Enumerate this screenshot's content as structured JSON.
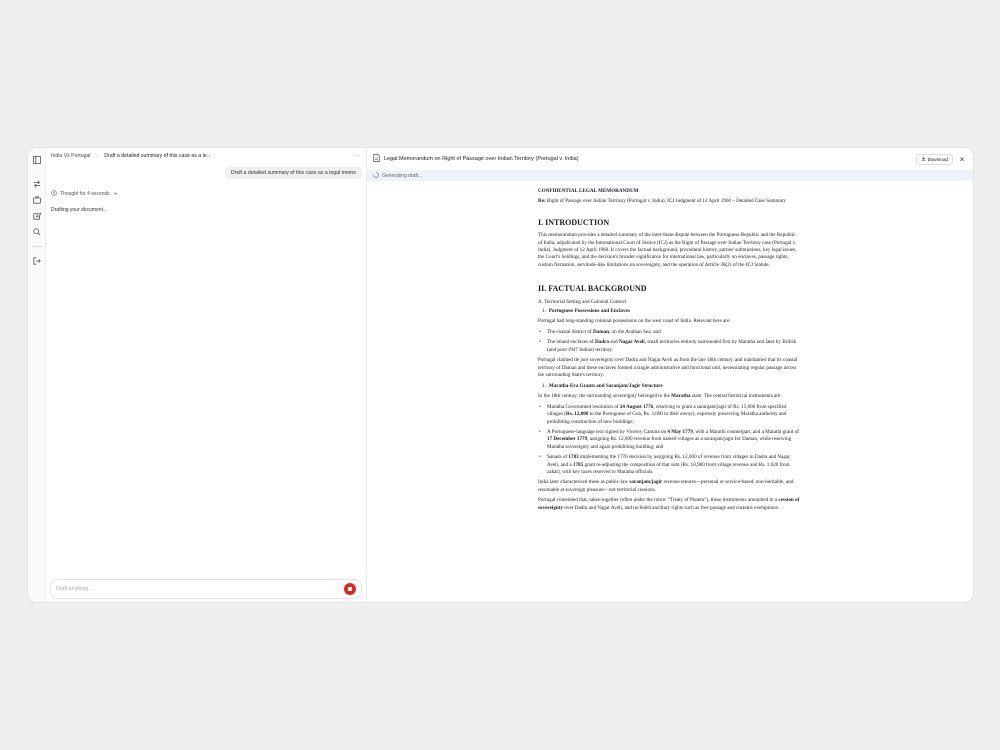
{
  "chat": {
    "breadcrumb": [
      "India Vs Portugal",
      "Draft a detailed summary of this case as a le..."
    ],
    "more_label": "···",
    "user_message": "Draft a detailed summary of this case as a legal memo",
    "thought_label": "Thought for 4 seconds",
    "status": "Drafting your document...",
    "input_placeholder": "Draft anything..."
  },
  "doc": {
    "title": "Legal Memorandum on Right of Passage over Indian Territory (Portugal v. India)",
    "download_label": "Download",
    "generating_label": "Generating draft...",
    "heading": "CONFIDENTIAL LEGAL MEMORANDUM",
    "re_label": "Re:",
    "re_text": "Right of Passage over Indian Territory (Portugal v. India), ICJ Judgment of 12 April 1960 – Detailed Case Summary",
    "section1_title": "I. INTRODUCTION",
    "section1_body": "This memorandum provides a detailed summary of the inter-State dispute between the Portuguese Republic and the Republic of India, adjudicated by the International Court of Justice (ICJ) as the Right of Passage over Indian Territory case (Portugal v. India), Judgment of 12 April 1960. It covers the factual background, procedural history, parties' submissions, key legal issues, the Court's holdings, and the decision's broader significance for international law, particularly on enclaves, passage rights, custom formation, servitude-like limitations on sovereignty, and the operation of Article 36(2) of the ICJ Statute.",
    "section2_title": "II. FACTUAL BACKGROUND",
    "sub_a": "A. Territorial Setting and Colonial Context",
    "item1_num": "1.",
    "item1_title": "Portuguese Possessions and Enclaves",
    "p_possessions": "Portugal had long-standing colonial possessions on the west coast of India. Relevant here are:",
    "b1_pre": "The coastal district of ",
    "b1_bold": "Daman",
    "b1_post": ", on the Arabian Sea; and",
    "b2_pre": "The inland enclaves of ",
    "b2_bold1": "Dadra",
    "b2_mid": " and ",
    "b2_bold2": "Nagar Aveli",
    "b2_post": ", small territories entirely surrounded first by Maratha and later by British (and post-1947 Indian) territory.",
    "p_sovereignty": "Portugal claimed de jure sovereignty over Dadra and Nagar Aveli as from the late 18th century, and maintained that its coastal territory of Daman and these enclaves formed a single administrative and functional unit, necessitating regular passage across the surrounding State's territory.",
    "item2_num": "1.",
    "item2_title": "Maratha-Era Grants and Saranjam/Jagir Structure",
    "p_maratha_pre": "In the 18th century, the surrounding sovereignty belonged to the ",
    "p_maratha_bold": "Maratha",
    "p_maratha_post": " state. The central historical instruments are:",
    "c1_pre": "Maratha Government resolution of ",
    "c1_b1": "24 August 1776",
    "c1_mid1": ", resolving to grant a saranjam/jagir of Rs. 15,000 from specified villages (",
    "c1_b2": "Rs. 12,000",
    "c1_post": " to the Portuguese of Goa, Rs. 3,000 to their envoy), expressly preserving Maratha authority and prohibiting construction of new buildings;",
    "c2_pre": "A Portuguese-language text signed by Viceroy Camara on ",
    "c2_b1": "4 May 1779",
    "c2_mid1": ", with a Marathi counterpart, and a Marathi grant of ",
    "c2_b2": "17 December 1779",
    "c2_post": ", assigning Rs. 12,000 revenue from named villages as a saranjam/jagir for Daman, while reserving Maratha sovereignty and again prohibiting building; and",
    "c3_pre": "Sanads of ",
    "c3_b1": "1783",
    "c3_mid1": " implementing the 1776 decision by assigning Rs. 12,000 of revenue from villages in Dadra and Nagar Aveli, and a ",
    "c3_b2": "1785",
    "c3_post": " grant re-adjusting the composition of that sum (Rs. 10,980 from village revenue and Rs. 1,020 from zakat), with key taxes reserved to Maratha officials.",
    "p_later_pre": "India later characterised these as public-law ",
    "p_later_bold": "saranjam/jagir",
    "p_later_post": " revenue tenures—personal or service-based, non-heritable, and resumable at sovereign pleasure—not territorial cessions.",
    "p_portugal_pre": "Portugal contended that, taken together (often under the rubric “Treaty of Punem”), these instruments amounted to a ",
    "p_portugal_bold": "cession of sovereignty",
    "p_portugal_post": " over Dadra and Nagar Aveli, and included ancillary rights such as free passage and customs exemptions."
  },
  "colors": {
    "accent_red": "#e02424",
    "generating_bg": "#eef2fb"
  },
  "icons": [
    "sidebar-toggle-icon",
    "swap-icon",
    "briefcase-icon",
    "edit-icon",
    "search-icon",
    "logout-icon",
    "thought-icon",
    "chevron-down-icon",
    "document-icon",
    "download-icon",
    "close-icon",
    "spinner-icon",
    "stop-icon"
  ]
}
